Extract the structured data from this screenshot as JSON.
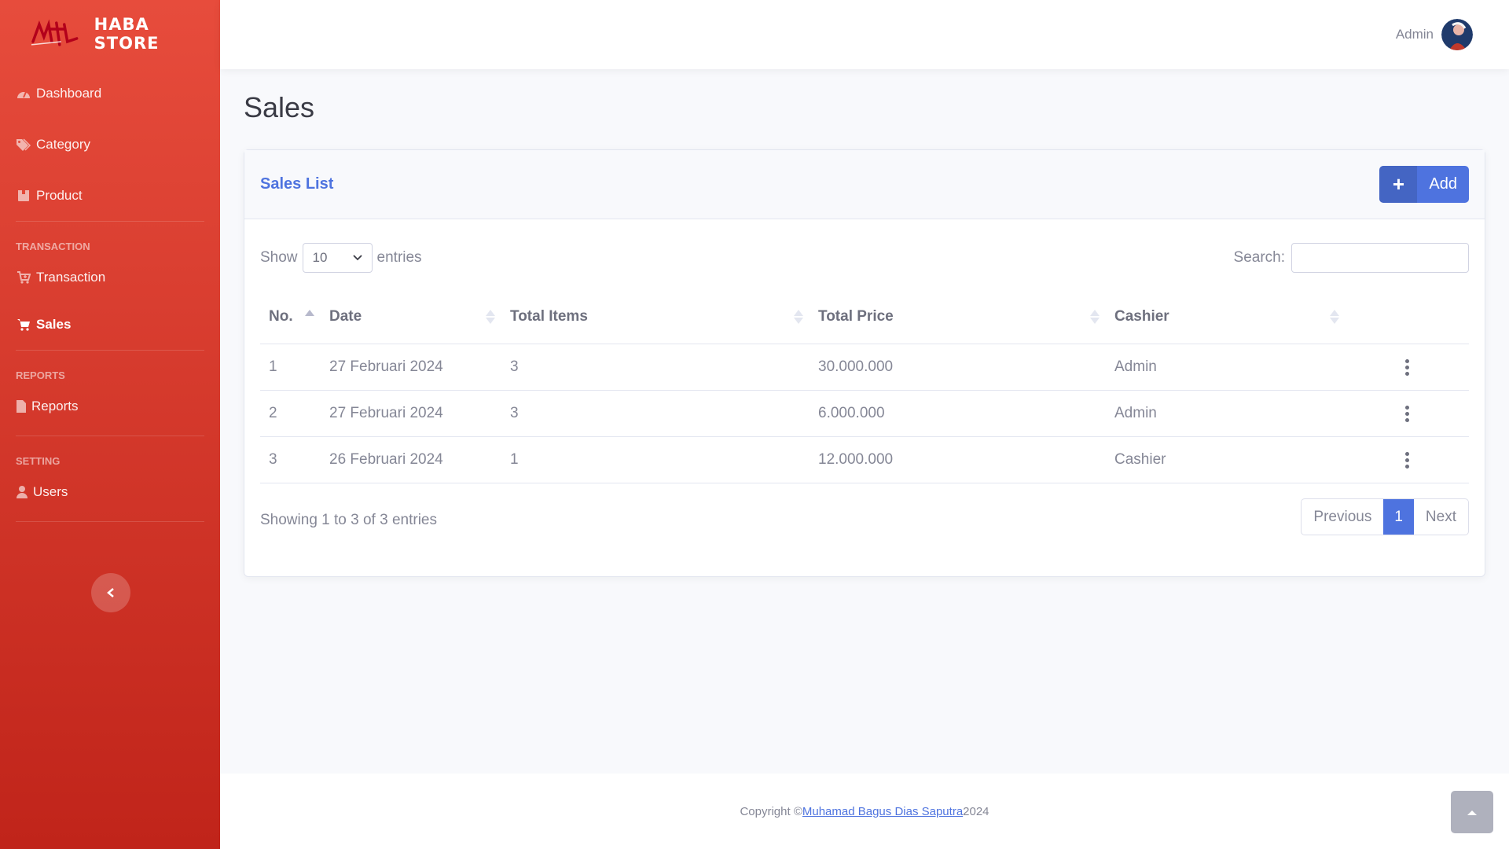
{
  "brand": {
    "name": "HABA STORE",
    "logo_icon": "haba-logo"
  },
  "sidebar": {
    "items": [
      {
        "label": "Dashboard",
        "icon": "dashboard-gauge-icon"
      },
      {
        "label": "Category",
        "icon": "tags-icon"
      },
      {
        "label": "Product",
        "icon": "box-icon"
      }
    ],
    "heading_transaction": "TRANSACTION",
    "transaction_items": [
      {
        "label": "Transaction",
        "icon": "cart-plus-icon"
      },
      {
        "label": "Sales",
        "icon": "cart-icon",
        "active": true
      }
    ],
    "heading_reports": "REPORTS",
    "reports_items": [
      {
        "label": "Reports",
        "icon": "file-icon"
      }
    ],
    "heading_setting": "SETTING",
    "setting_items": [
      {
        "label": "Users",
        "icon": "user-icon"
      }
    ]
  },
  "topbar": {
    "user_name": "Admin"
  },
  "page": {
    "title": "Sales"
  },
  "card": {
    "title": "Sales List",
    "add_label": "Add",
    "show_label": "Show",
    "entries_label": "entries",
    "page_length": "10",
    "search_label": "Search:",
    "search_value": ""
  },
  "table": {
    "headers": [
      "No.",
      "Date",
      "Total Items",
      "Total Price",
      "Cashier"
    ],
    "rows": [
      {
        "no": "1",
        "date": "27 Februari 2024",
        "items": "3",
        "price": "30.000.000",
        "cashier": "Admin"
      },
      {
        "no": "2",
        "date": "27 Februari 2024",
        "items": "3",
        "price": "6.000.000",
        "cashier": "Admin"
      },
      {
        "no": "3",
        "date": "26 Februari 2024",
        "items": "1",
        "price": "12.000.000",
        "cashier": "Cashier"
      }
    ]
  },
  "pagination": {
    "info": "Showing 1 to 3 of 3 entries",
    "previous": "Previous",
    "current": "1",
    "next": "Next"
  },
  "footer": {
    "prefix": "Copyright © ",
    "author": "Muhamad Bagus Dias Saputra ",
    "year": "2024"
  },
  "colors": {
    "sidebar_top": "#e74c3c",
    "sidebar_bottom": "#c0241a",
    "primary": "#4e73df"
  }
}
